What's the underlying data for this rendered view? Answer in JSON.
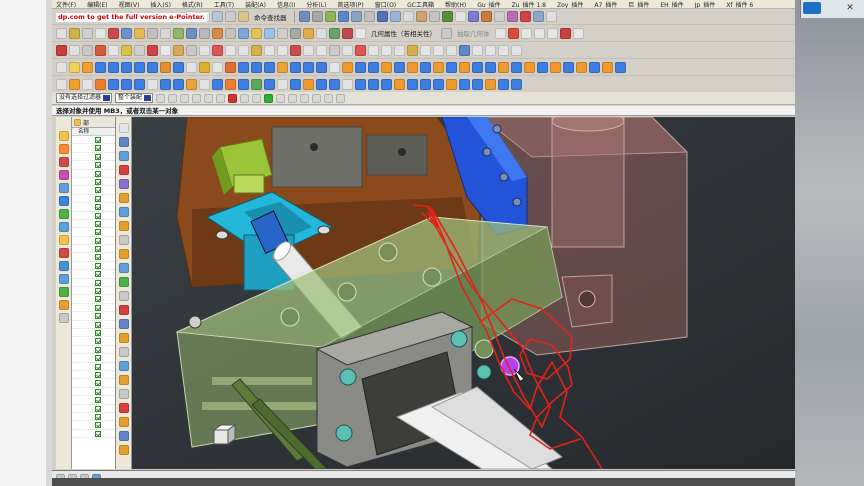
{
  "menubar": {
    "items": [
      "文件(F)",
      "编辑(E)",
      "视图(V)",
      "插入(S)",
      "格式(R)",
      "工具(T)",
      "装配(A)",
      "信息(I)",
      "分析(L)",
      "首选项(P)",
      "窗口(O)",
      "GC工具箱",
      "帮助(H)",
      "Gu_插件",
      "Zu_插件 1.8",
      "Zoy_插件",
      "A7_插件",
      "巨_插件",
      "EH_插件",
      "Jp_插件",
      "Xf_插件 6"
    ]
  },
  "promo_text": "dp.com to get the full version e-Pointer.",
  "toolbar1": {
    "command_finder": "命令查找器"
  },
  "toolbar2": {
    "geometric_property": "几何属性（若相关性）",
    "extract_label": "抽取几何体"
  },
  "filterbar": {
    "type_filter": "没有选择过滤器",
    "assembly_filter": "整个装配"
  },
  "status_text": "选择对象并使用 MB3，或者双击某一对象",
  "nav": {
    "tab_label": "部",
    "column_name": "名称",
    "row_count": 36
  },
  "colors": {
    "accent": "#d82418",
    "ui_face": "#d4d0c8",
    "viewport_bg": "#2e3338"
  },
  "icons": {
    "undo": "undo-icon",
    "redo": "redo-icon",
    "cut": "cut-icon",
    "copy": "copy-icon",
    "paste": "paste-icon",
    "search": "search-icon"
  }
}
